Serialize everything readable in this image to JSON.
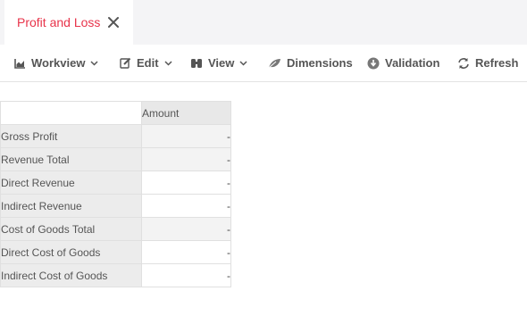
{
  "tab": {
    "title": "Profit and Loss",
    "close_icon": "close-icon"
  },
  "toolbar": {
    "workview": {
      "label": "Workview",
      "icon": "area-chart-icon"
    },
    "edit": {
      "label": "Edit",
      "icon": "edit-icon"
    },
    "view": {
      "label": "View",
      "icon": "binoculars-icon"
    },
    "dimensions": {
      "label": "Dimensions",
      "icon": "leaf-icon"
    },
    "validation": {
      "label": "Validation",
      "icon": "download-circle-icon"
    },
    "refresh": {
      "label": "Refresh",
      "icon": "refresh-icon"
    }
  },
  "grid": {
    "column_header": "Amount",
    "rows": [
      {
        "label": "Gross Profit",
        "value": "-"
      },
      {
        "label": "Revenue Total",
        "value": "-"
      },
      {
        "label": "Direct Revenue",
        "value": "-"
      },
      {
        "label": "Indirect Revenue",
        "value": "-"
      },
      {
        "label": "Cost of Goods Total",
        "value": "-"
      },
      {
        "label": "Direct Cost of Goods",
        "value": "-"
      },
      {
        "label": "Indirect Cost of Goods",
        "value": "-"
      }
    ]
  },
  "colors": {
    "accent": "#e8334a",
    "toolbar_text": "#555555",
    "header_bg": "#e8e8e8"
  }
}
